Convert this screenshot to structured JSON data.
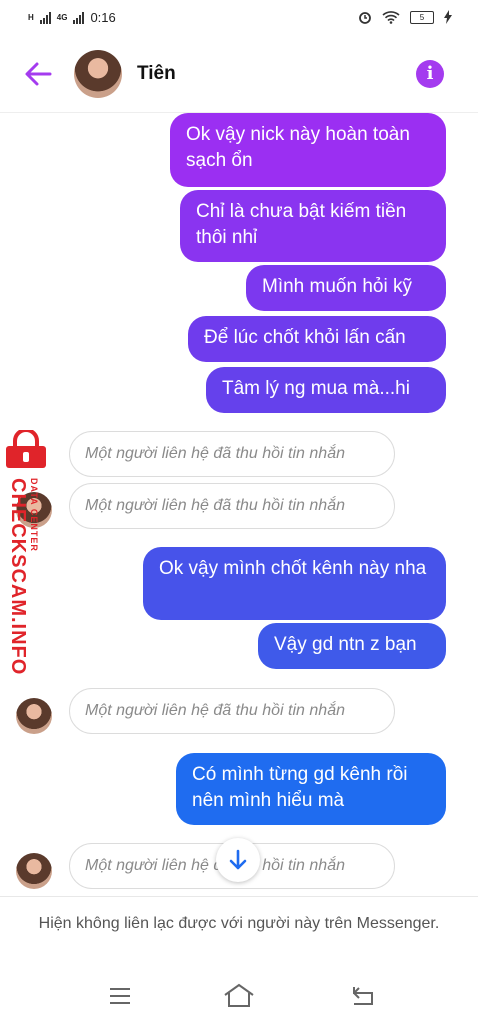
{
  "status": {
    "time": "0:16",
    "left_indicators": "H 4G",
    "battery": "5"
  },
  "header": {
    "contact_name": "Tiên"
  },
  "messages": {
    "m1": "Ok vậy nick này hoàn toàn sạch ổn",
    "m2": "Chỉ là chưa bật kiếm tiền thôi nhỉ",
    "m3": "Mình muốn hỏi kỹ",
    "m4": "Để lúc chốt khỏi lấn cấn",
    "m5": "Tâm lý ng mua mà...hi",
    "m6": "Ok vậy mình chốt kênh này nha",
    "m7": "Vậy gd ntn z bạn",
    "m8": "Có mình từng gd kênh rồi nên mình hiểu mà",
    "recalled": "Một người liên hệ đã thu hồi tin nhắn"
  },
  "watermark": {
    "main": "CHECKSCAM.INFO",
    "sub": "DATA CENTER"
  },
  "footer": {
    "notice": "Hiện không liên lạc được với người này trên Messenger."
  },
  "colors": {
    "accent": "#a43bef",
    "watermark": "#e0242a"
  },
  "icons": [
    "back-arrow-icon",
    "info-icon",
    "arrow-down-icon",
    "lock-icon",
    "menu-icon",
    "home-icon",
    "back-nav-icon"
  ]
}
